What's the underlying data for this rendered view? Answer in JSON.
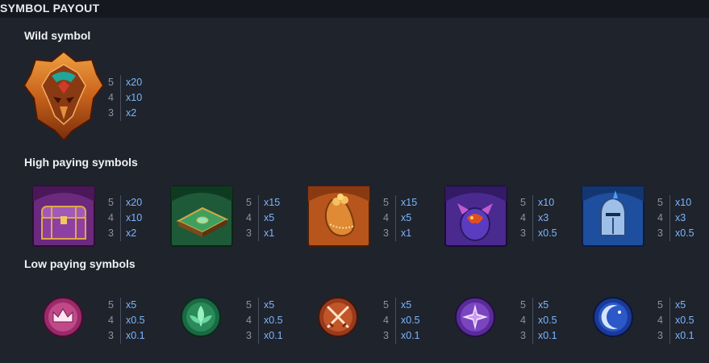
{
  "header": {
    "title": "SYMBOL PAYOUT"
  },
  "sections": {
    "wild": "Wild symbol",
    "high": "High paying symbols",
    "low": "Low paying symbols"
  },
  "colors": {
    "background": "#1f232c",
    "header_bar": "#15181e",
    "count_text": "#8c93a3",
    "multiplier_text": "#7bb6ff"
  },
  "wild_symbol": {
    "icon": "wild-mask-icon",
    "payouts": [
      {
        "count": "5",
        "mult": "x20"
      },
      {
        "count": "4",
        "mult": "x10"
      },
      {
        "count": "3",
        "mult": "x2"
      }
    ]
  },
  "high_symbols": [
    {
      "icon": "treasure-chest-icon",
      "payouts": [
        {
          "count": "5",
          "mult": "x20"
        },
        {
          "count": "4",
          "mult": "x10"
        },
        {
          "count": "3",
          "mult": "x2"
        }
      ]
    },
    {
      "icon": "spellbook-icon",
      "payouts": [
        {
          "count": "5",
          "mult": "x15"
        },
        {
          "count": "4",
          "mult": "x5"
        },
        {
          "count": "3",
          "mult": "x1"
        }
      ]
    },
    {
      "icon": "gold-pouch-icon",
      "payouts": [
        {
          "count": "5",
          "mult": "x15"
        },
        {
          "count": "4",
          "mult": "x5"
        },
        {
          "count": "3",
          "mult": "x1"
        }
      ]
    },
    {
      "icon": "dragon-egg-icon",
      "payouts": [
        {
          "count": "5",
          "mult": "x10"
        },
        {
          "count": "4",
          "mult": "x3"
        },
        {
          "count": "3",
          "mult": "x0.5"
        }
      ]
    },
    {
      "icon": "knight-helmet-icon",
      "payouts": [
        {
          "count": "5",
          "mult": "x10"
        },
        {
          "count": "4",
          "mult": "x3"
        },
        {
          "count": "3",
          "mult": "x0.5"
        }
      ]
    }
  ],
  "low_symbols": [
    {
      "icon": "crown-emblem-icon",
      "payouts": [
        {
          "count": "5",
          "mult": "x5"
        },
        {
          "count": "4",
          "mult": "x0.5"
        },
        {
          "count": "3",
          "mult": "x0.1"
        }
      ]
    },
    {
      "icon": "leaf-emblem-icon",
      "payouts": [
        {
          "count": "5",
          "mult": "x5"
        },
        {
          "count": "4",
          "mult": "x0.5"
        },
        {
          "count": "3",
          "mult": "x0.1"
        }
      ]
    },
    {
      "icon": "crossed-swords-emblem-icon",
      "payouts": [
        {
          "count": "5",
          "mult": "x5"
        },
        {
          "count": "4",
          "mult": "x0.5"
        },
        {
          "count": "3",
          "mult": "x0.1"
        }
      ]
    },
    {
      "icon": "star-emblem-icon",
      "payouts": [
        {
          "count": "5",
          "mult": "x5"
        },
        {
          "count": "4",
          "mult": "x0.5"
        },
        {
          "count": "3",
          "mult": "x0.1"
        }
      ]
    },
    {
      "icon": "moon-emblem-icon",
      "payouts": [
        {
          "count": "5",
          "mult": "x5"
        },
        {
          "count": "4",
          "mult": "x0.5"
        },
        {
          "count": "3",
          "mult": "x0.1"
        }
      ]
    }
  ]
}
